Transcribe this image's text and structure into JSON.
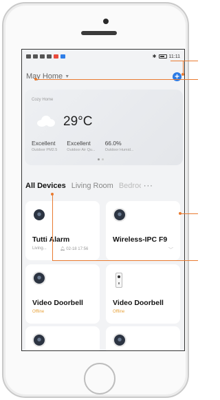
{
  "status_bar": {
    "time": "11:11"
  },
  "header": {
    "home_name": "May Home",
    "add_icon": "plus-icon"
  },
  "weather": {
    "label": "Cozy Home",
    "temperature": "29°C",
    "icon": "cloud-icon",
    "stats": [
      {
        "value": "Excellent",
        "label": "Outdoor PM2.5"
      },
      {
        "value": "Excellent",
        "label": "Outdoor Air Qu..."
      },
      {
        "value": "66.0%",
        "label": "Outdoor Humid..."
      }
    ]
  },
  "tabs": {
    "items": [
      "All Devices",
      "Living Room",
      "Bedroo"
    ],
    "more": "···"
  },
  "devices": [
    {
      "name": "Tutti Alarm",
      "room": "Living...",
      "time": "02-18 17:56",
      "icon": "camera-icon"
    },
    {
      "name": "Wireless-IPC F9",
      "status": "",
      "icon": "camera-icon"
    },
    {
      "name": "Video Doorbell",
      "status": "Offline",
      "icon": "camera-icon"
    },
    {
      "name": "Video Doorbell",
      "status": "Offline",
      "icon": "doorbell-icon"
    },
    {
      "name": "",
      "icon": "camera-icon"
    },
    {
      "name": "",
      "icon": "camera-icon"
    }
  ],
  "colors": {
    "accent": "#2c7be5",
    "callout": "#e97a2f",
    "offline": "#e8a23a"
  }
}
